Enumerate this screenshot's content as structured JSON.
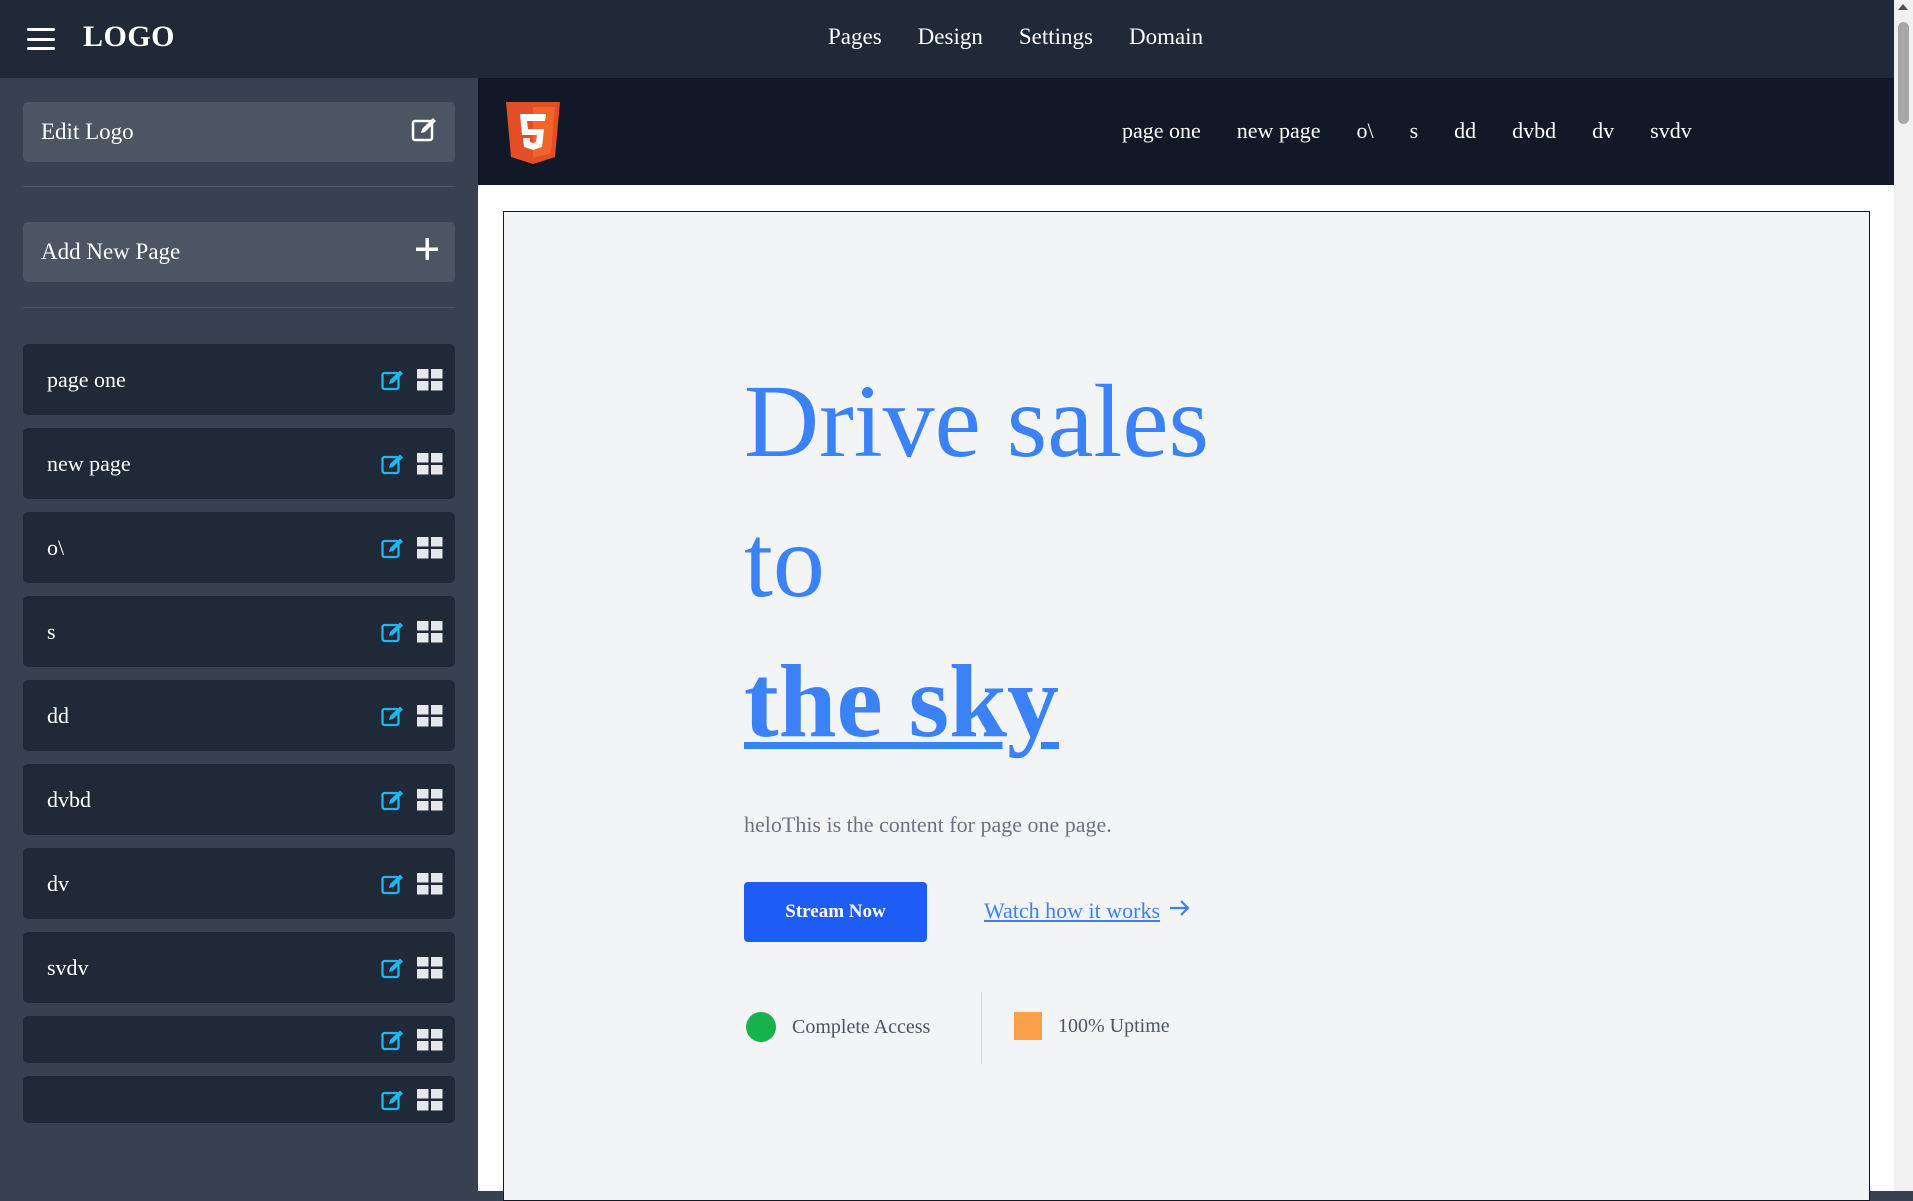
{
  "topbar": {
    "logo": "LOGO",
    "nav": [
      "Pages",
      "Design",
      "Settings",
      "Domain"
    ]
  },
  "sidebar": {
    "edit_logo_label": "Edit Logo",
    "add_page_label": "Add New Page",
    "pages": [
      {
        "label": "page one"
      },
      {
        "label": "new page"
      },
      {
        "label": "o\\"
      },
      {
        "label": "s"
      },
      {
        "label": "dd"
      },
      {
        "label": "dvbd"
      },
      {
        "label": "dv"
      },
      {
        "label": "svdv"
      },
      {
        "label": ""
      },
      {
        "label": ""
      }
    ]
  },
  "preview": {
    "site_nav": [
      "page one",
      "new page",
      "o\\",
      "s",
      "dd",
      "dvbd",
      "dv",
      "svdv"
    ],
    "hero": {
      "line1": "Drive sales",
      "line2": "to",
      "emphasis": "the sky",
      "subtitle": "heloThis is the content for page one page.",
      "primary_button": "Stream Now",
      "secondary_link": "Watch how it works"
    },
    "badges": [
      {
        "label": "Complete Access"
      },
      {
        "label": "100% Uptime"
      }
    ]
  },
  "colors": {
    "topbar_bg": "#1f2937",
    "sidebar_bg": "#374151",
    "accent_blue": "#3b82f6",
    "primary_button": "#1d5cf5",
    "edit_icon": "#1fb7f0",
    "html5_orange": "#e44d26",
    "badge_green": "#16b34a",
    "badge_orange": "#fb9f4a"
  },
  "icons": {
    "menu": "hamburger-icon",
    "edit": "edit-icon",
    "add": "plus-icon",
    "layout": "grid-icon",
    "brand": "html5-logo",
    "arrow": "arrow-right-icon"
  }
}
